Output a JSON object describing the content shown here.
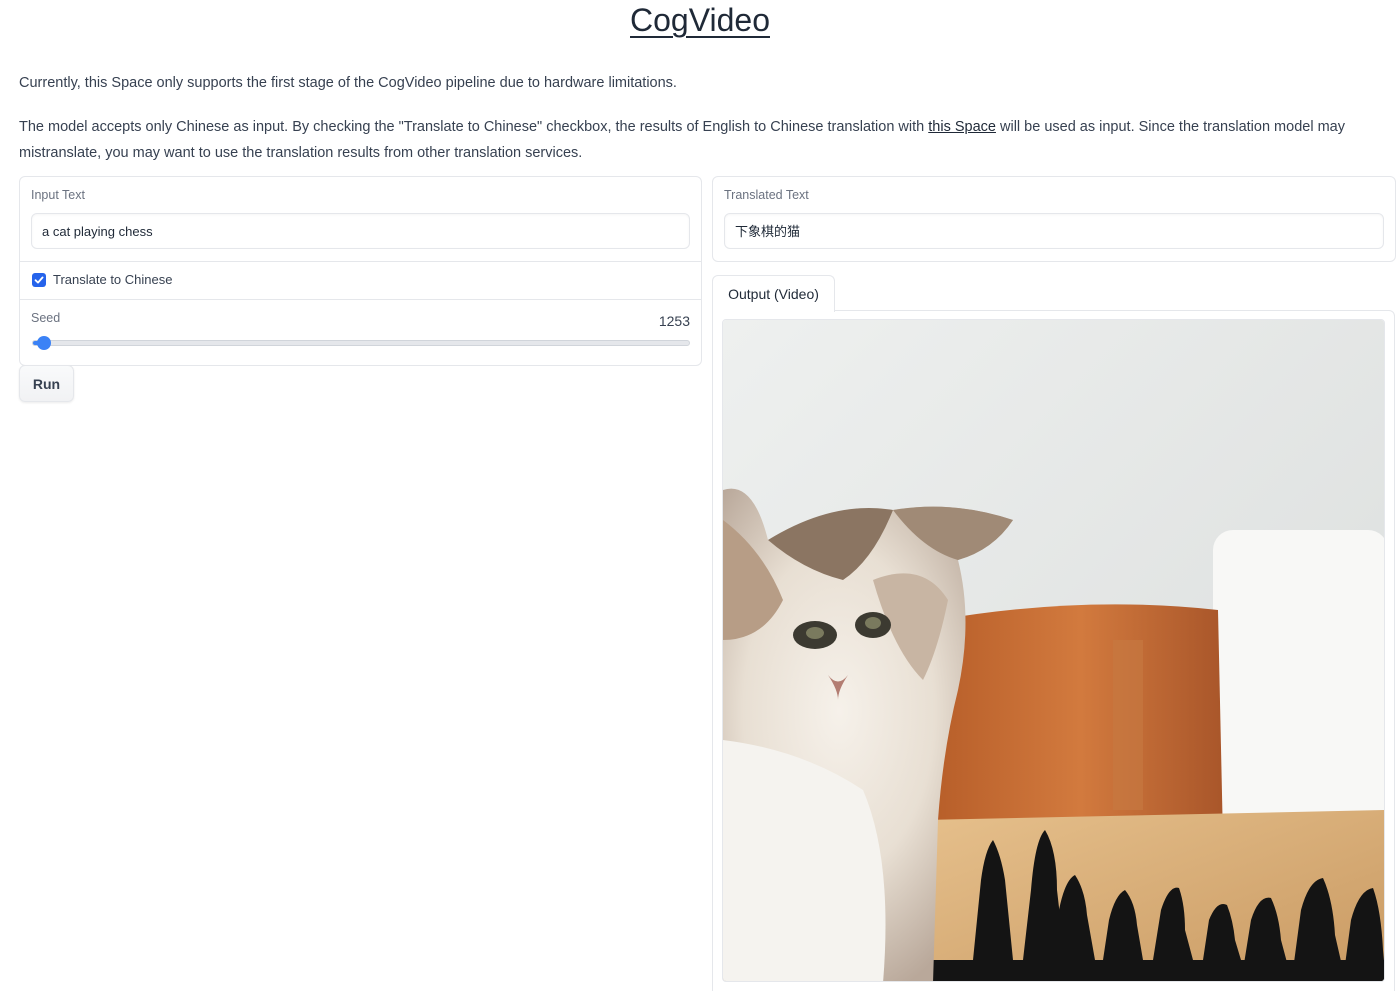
{
  "header": {
    "title": "CogVideo"
  },
  "description": {
    "line1": "Currently, this Space only supports the first stage of the CogVideo pipeline due to hardware limitations.",
    "line2_before": "The model accepts only Chinese as input. By checking the \"Translate to Chinese\" checkbox, the results of English to Chinese translation with ",
    "line2_link": "this Space",
    "line2_after": " will be used as input. Since the translation model may mistranslate, you may want to use the translation results from other translation services."
  },
  "inputs": {
    "input_text_label": "Input Text",
    "input_text_value": "a cat playing chess",
    "translate_label": "Translate to Chinese",
    "translate_checked": true,
    "seed_label": "Seed",
    "seed_value": "1253",
    "seed_fraction": 0.01,
    "run_label": "Run"
  },
  "outputs": {
    "translated_label": "Translated Text",
    "translated_value": "下象棋的猫",
    "tab_label": "Output (Video)",
    "video_icon": "cat-with-chess-pieces-frame"
  },
  "colors": {
    "accent": "#3b82f6",
    "checkbox": "#2563eb",
    "border": "#e5e7eb"
  }
}
